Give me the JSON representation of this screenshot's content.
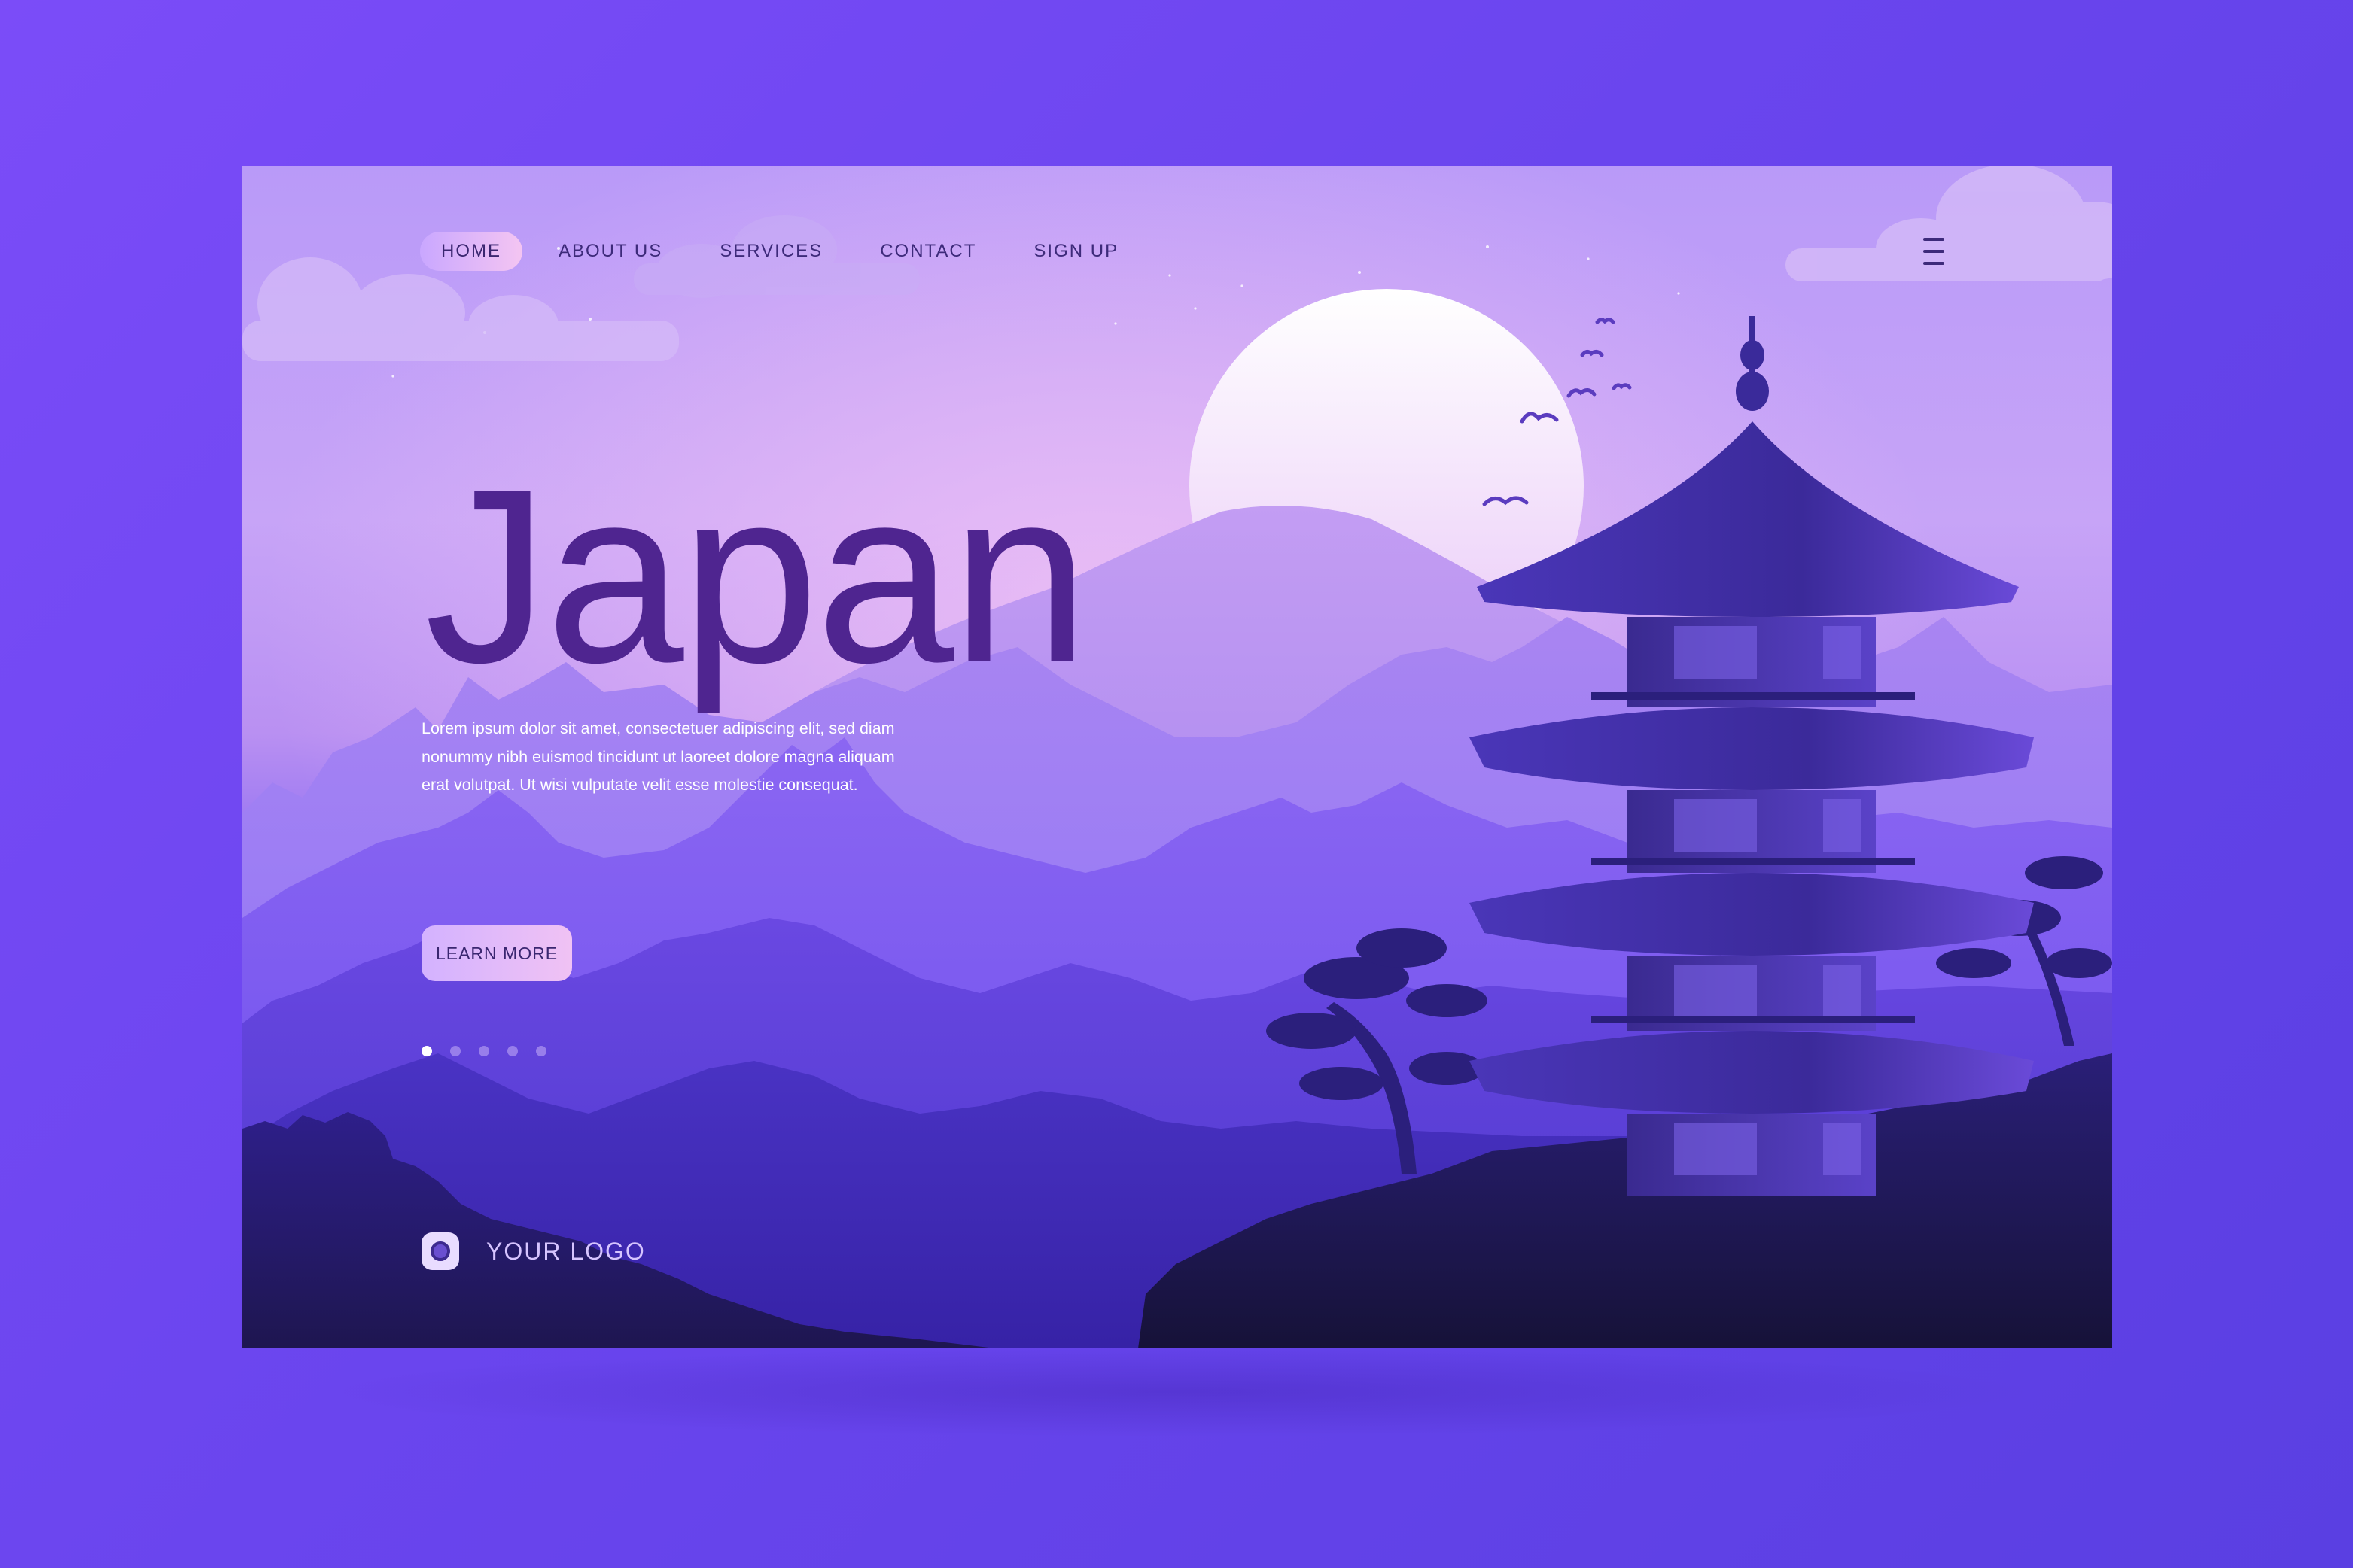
{
  "nav": {
    "items": [
      {
        "label": "HOME",
        "active": true
      },
      {
        "label": "ABOUT US",
        "active": false
      },
      {
        "label": "SERVICES",
        "active": false
      },
      {
        "label": "CONTACT",
        "active": false
      },
      {
        "label": "SIGN UP",
        "active": false
      }
    ],
    "menu_icon": "hamburger-icon"
  },
  "hero": {
    "title": "Japan",
    "description": "Lorem ipsum dolor sit amet, consectetuer adipiscing elit, sed diam nonummy nibh euismod tincidunt ut laoreet dolore magna aliquam erat volutpat. Ut wisi vulputate velit esse molestie consequat.",
    "cta_label": "LEARN MORE"
  },
  "slider": {
    "total": 5,
    "active_index": 0
  },
  "footer": {
    "logo_text": "YOUR LOGO"
  },
  "colors": {
    "page_background": "#6a45ee",
    "title": "#4f2590",
    "nav_text": "#3d2a7a",
    "button_gradient_start": "#d3b2ff",
    "button_gradient_end": "#f0c2f4",
    "pagoda": "#3f2b9a"
  }
}
